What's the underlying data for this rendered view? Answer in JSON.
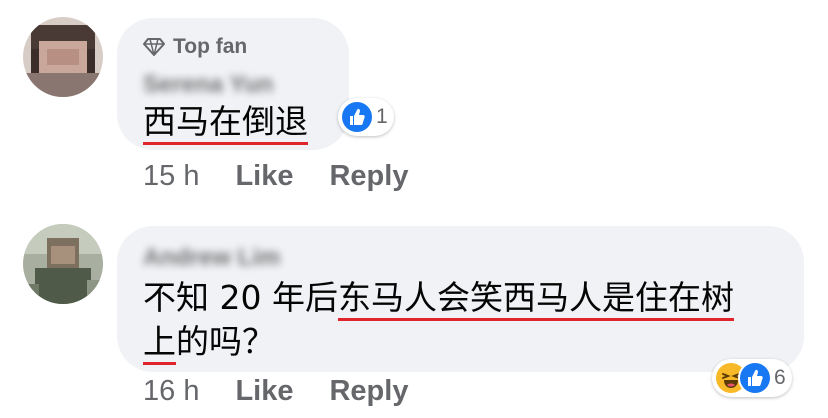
{
  "comments": [
    {
      "badge": "Top fan",
      "author": "Serena Yun",
      "text_plain": "西马在倒退",
      "time": "15 h",
      "like_label": "Like",
      "reply_label": "Reply",
      "reaction_count": "1",
      "reactions": [
        "like-icon"
      ]
    },
    {
      "author": "Andrew Lim",
      "line1_plain": "不知 20 年后",
      "line1_underlined": "东马人会笑西马人是住在树",
      "line2_underlined": "上",
      "line2_plain": "的吗？",
      "time": "16 h",
      "like_label": "Like",
      "reply_label": "Reply",
      "reaction_count": "6",
      "reactions": [
        "haha-icon",
        "like-icon"
      ]
    }
  ],
  "colors": {
    "bubble": "#f0f2f5",
    "secondary_text": "#65676b",
    "like_blue": "#1877f2",
    "underline_red": "#e0242c",
    "haha_yellow": "#f7b928"
  }
}
